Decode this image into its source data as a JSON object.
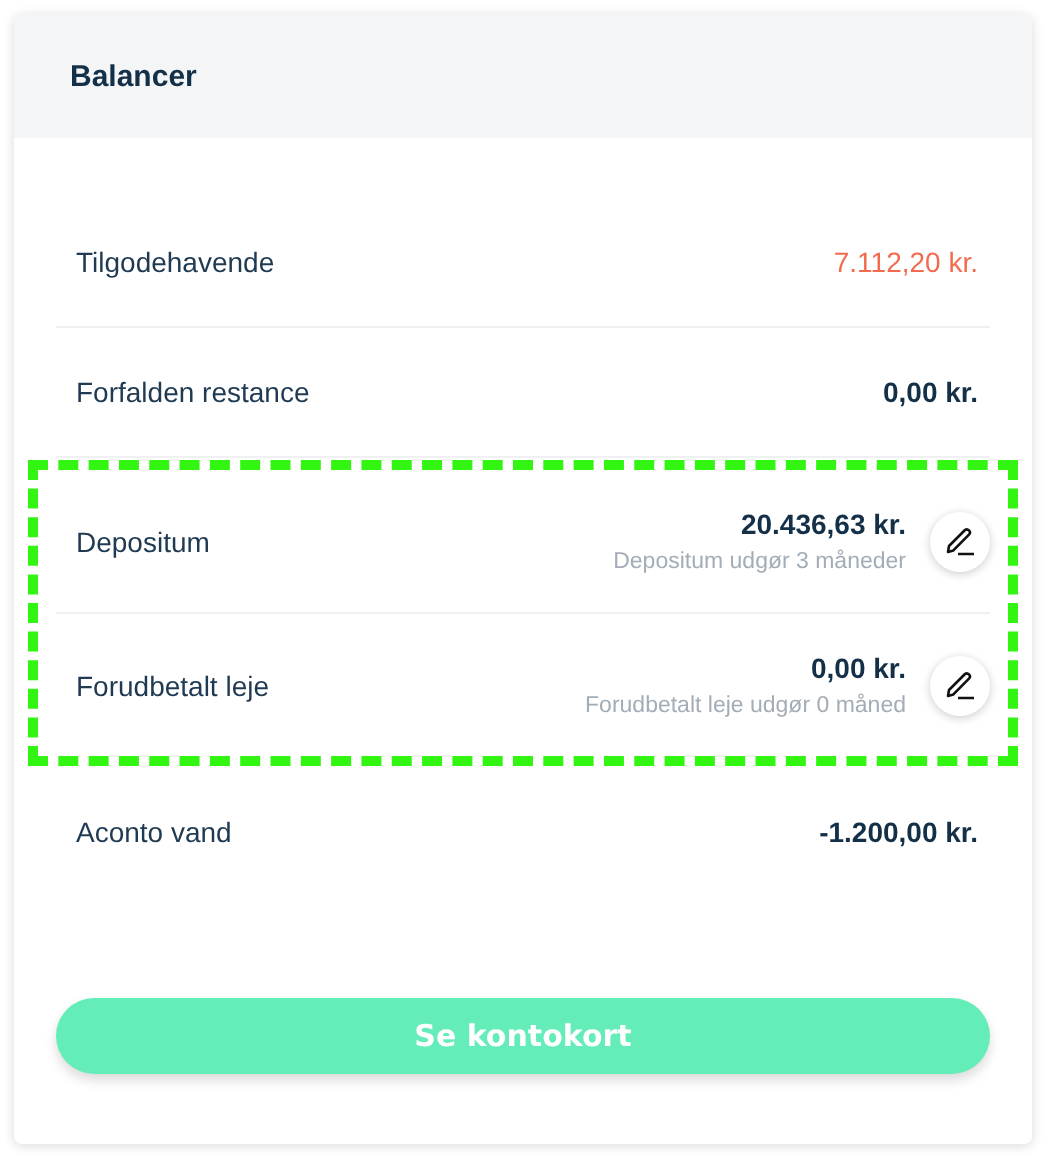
{
  "card": {
    "title": "Balancer"
  },
  "rows": [
    {
      "label": "Tilgodehavende",
      "value": "7.112,20 kr.",
      "color": "#f26b4f",
      "editable": false,
      "highlighted": false
    },
    {
      "label": "Forfalden restance",
      "value": "0,00 kr.",
      "color": "#143049",
      "editable": false,
      "highlighted": false
    },
    {
      "label": "Depositum",
      "value": "20.436,63 kr.",
      "note": "Depositum udgør 3 måneder",
      "color": "#143049",
      "editable": true,
      "highlighted": true
    },
    {
      "label": "Forudbetalt leje",
      "value": "0,00 kr.",
      "note": "Forudbetalt leje udgør 0 måned",
      "color": "#143049",
      "editable": true,
      "highlighted": true
    },
    {
      "label": "Aconto vand",
      "value": "-1.200,00 kr.",
      "color": "#143049",
      "editable": false,
      "highlighted": false
    }
  ],
  "button": {
    "label": "Se kontokort"
  }
}
